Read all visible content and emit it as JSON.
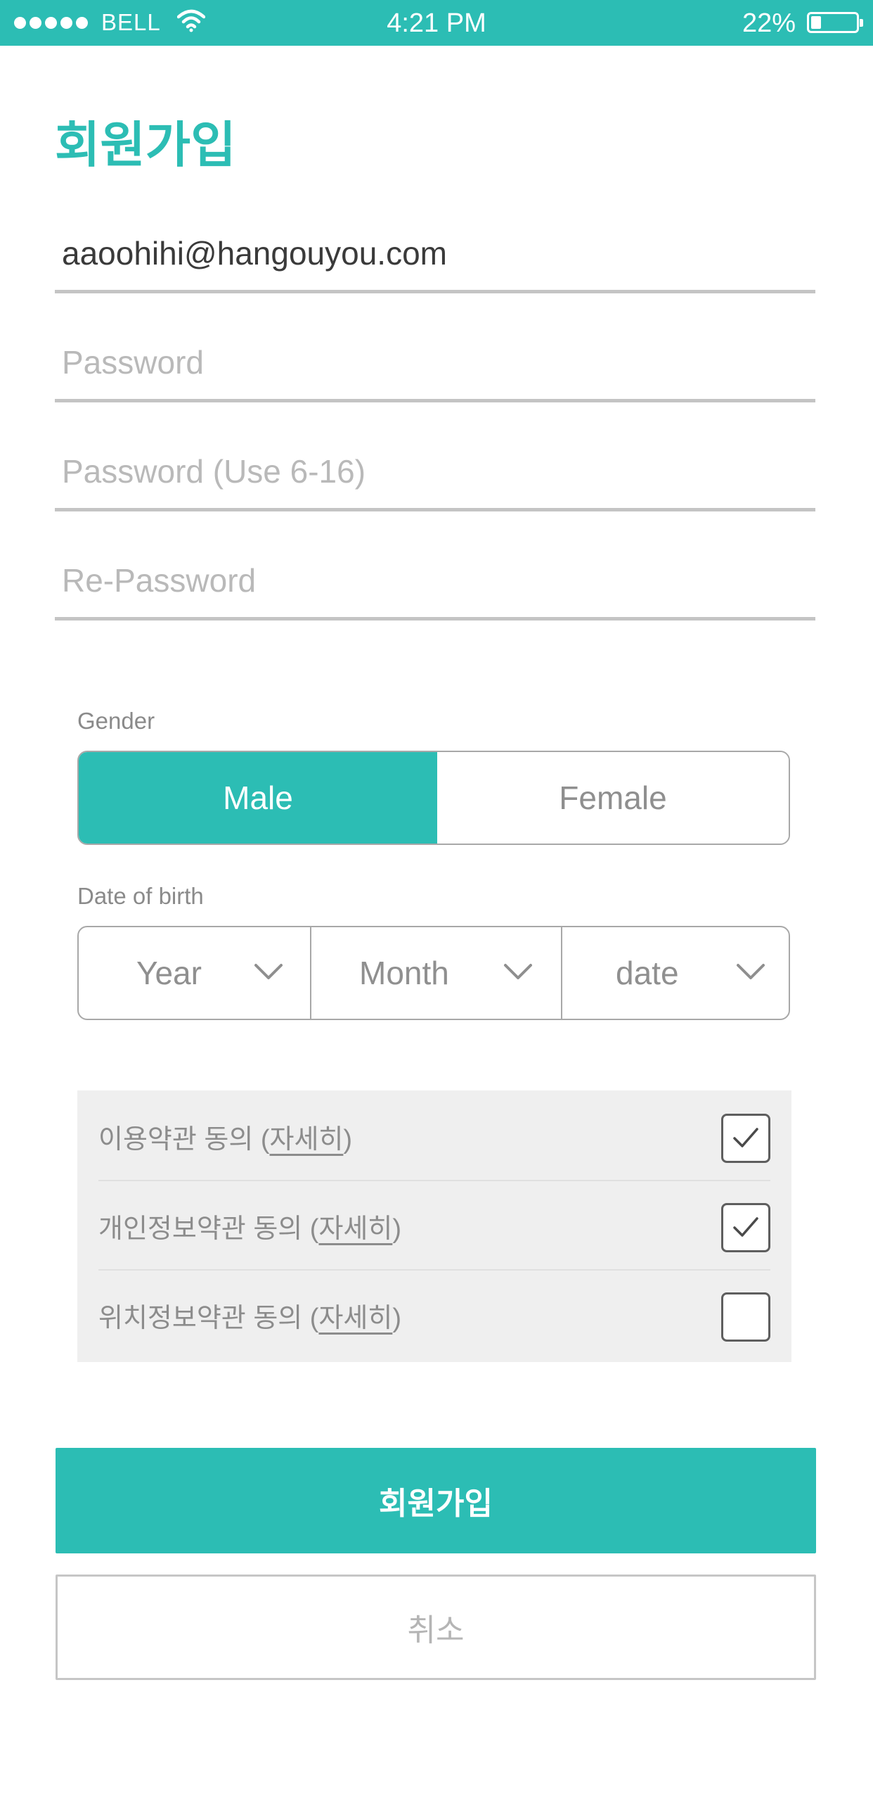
{
  "status_bar": {
    "carrier": "BELL",
    "time": "4:21 PM",
    "battery": "22%",
    "battery_level": 0.22
  },
  "page": {
    "title": "회원가입"
  },
  "form": {
    "email": {
      "value": "aaoohihi@hangouyou.com",
      "placeholder": ""
    },
    "password": {
      "value": "",
      "placeholder": "Password"
    },
    "password_rule": {
      "value": "",
      "placeholder": "Password (Use 6-16)"
    },
    "re_password": {
      "value": "",
      "placeholder": "Re-Password"
    }
  },
  "gender": {
    "label": "Gender",
    "options": [
      "Male",
      "Female"
    ],
    "selected": "Male"
  },
  "dob": {
    "label": "Date of birth",
    "year": "Year",
    "month": "Month",
    "date": "date"
  },
  "terms": [
    {
      "text": "이용약관 동의 (",
      "link": "자세히",
      "close": ")",
      "checked": true
    },
    {
      "text": "개인정보약관 동의 (",
      "link": "자세히",
      "close": ")",
      "checked": true
    },
    {
      "text": "위치정보약관 동의 (",
      "link": "자세히",
      "close": ")",
      "checked": false
    }
  ],
  "actions": {
    "submit": "회원가입",
    "cancel": "취소"
  },
  "colors": {
    "accent": "#2cbdb4",
    "divider": "#c4c4c4",
    "terms_bg": "#efefef"
  }
}
